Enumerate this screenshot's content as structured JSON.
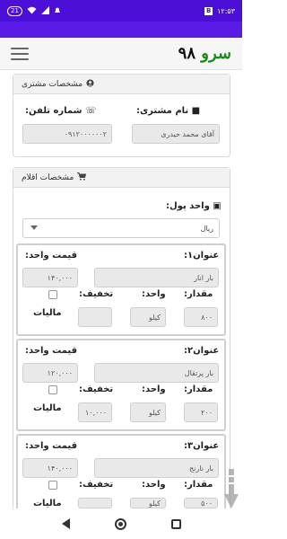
{
  "statusbar": {
    "notif_count": "21",
    "time": "۱۲:۵۳",
    "sim_label": "B"
  },
  "app": {
    "brand_main": "سرو",
    "brand_num": "۹۸"
  },
  "customer": {
    "header": "مشخصات مشتری",
    "name_label": "نام مشتری:",
    "name_value": "آقای محمد حیدری",
    "phone_label": "شماره تلفن:",
    "phone_value": "۰۹۱۲۰۰۰۰۰۰۲"
  },
  "items_section": {
    "header": "مشخصات اقلام",
    "currency_label": "واحد پول:",
    "currency_value": "ریال"
  },
  "labels": {
    "title_prefix": "عنوان",
    "unit_price": "قیمت واحد:",
    "quantity": "مقدار:",
    "unit": "واحد:",
    "discount": "تخفیف:",
    "tax": "مالیات"
  },
  "items": [
    {
      "title": "عنوان۱:",
      "name": "بار انار",
      "unit_price": "۱۴۰,۰۰۰",
      "quantity": "۸۰۰",
      "unit": "کیلو",
      "discount": ""
    },
    {
      "title": "عنوان۲:",
      "name": "بار پرتقال",
      "unit_price": "۱۲۰,۰۰۰",
      "quantity": "۲۰۰",
      "unit": "کیلو",
      "discount": "۱۰,۰۰۰"
    },
    {
      "title": "عنوان۳:",
      "name": "بار نارنج",
      "unit_price": "۱۴۰,۰۰۰",
      "quantity": "۵۰۰",
      "unit": "کیلو",
      "discount": ""
    }
  ]
}
